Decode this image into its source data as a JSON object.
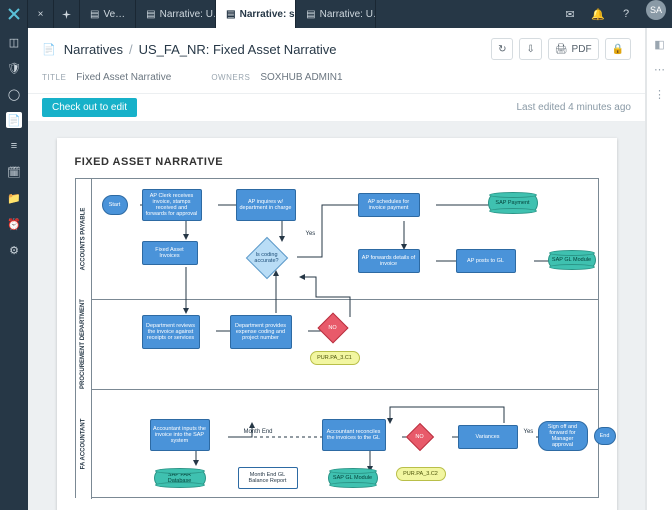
{
  "topbar": {
    "tabs": [
      {
        "label": "Ve…"
      },
      {
        "label": "Narrative: U…"
      },
      {
        "label": "Narrative: s…",
        "active": true
      },
      {
        "label": "Narrative: U…"
      }
    ],
    "avatar": "SA"
  },
  "header": {
    "crumbRoot": "Narratives",
    "crumbSep": "/",
    "crumbTitle": "US_FA_NR: Fixed Asset Narrative",
    "pdf": "PDF"
  },
  "meta": {
    "titleLabel": "TITLE",
    "title": "Fixed Asset Narrative",
    "ownersLabel": "OWNERS",
    "owners": "SOXHUB ADMIN1"
  },
  "strip": {
    "checkout": "Check out to edit",
    "lastEdited": "Last edited 4 minutes ago"
  },
  "page": {
    "title": "FIXED ASSET NARRATIVE",
    "lanes": [
      "ACCOUNTS PAYABLE",
      "PROCUREMENT DEPARTMENT",
      "FA ACCOUNTANT"
    ],
    "labels": {
      "yes": "Yes",
      "no": "No",
      "monthEnd": "Month End"
    },
    "nodes": {
      "start": "Start",
      "ap1": "AP Clerk receives invoice, stamps received and forwards for approval",
      "ap2": "AP inquires w/ department in charge",
      "ap3": "AP schedules for invoice payment",
      "ap4": "SAP Payment",
      "ap5": "Fixed Asset Invoices",
      "ap6": "Is coding accurate?",
      "ap7": "AP forwards details of invoice",
      "ap8": "AP posts to GL",
      "ap9": "SAP GL Module",
      "pd1": "Department reviews the invoice against receipts or services",
      "pd2": "Department provides expense coding and project number",
      "pd3": "NO",
      "ref1": "PUR.PA_3.C1",
      "fa1": "Accountant inputs the invoice into the SAP system",
      "fa2": "Accountant reconciles the invoices to the GL",
      "fa3": "NO",
      "fa4": "Variances",
      "fa5": "Sign off and forward for Manager approval",
      "fa6": "End",
      "fadb": "SAP FAR Database",
      "fagl": "SAP GL Module",
      "farep": "Month End GL Balance Report",
      "ref2": "PUR.PA_3.C2"
    }
  }
}
